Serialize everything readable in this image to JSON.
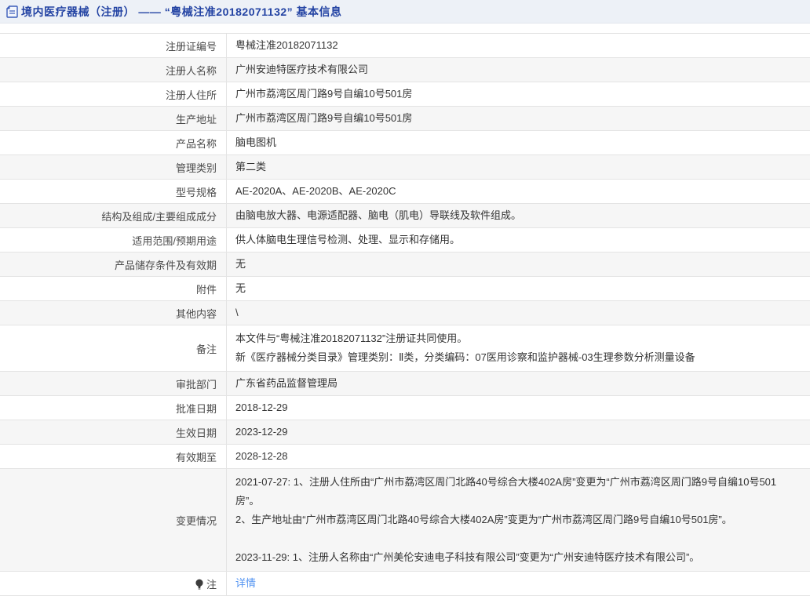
{
  "header": {
    "title": "境内医疗器械（注册） —— “粤械注准20182071132” 基本信息",
    "icon": "document-icon"
  },
  "colors": {
    "header_bg": "#edf1f7",
    "header_text": "#2343a3",
    "row_alt_bg": "#f6f6f6",
    "border": "#e4e4e4",
    "link": "#5595f2"
  },
  "table": {
    "rows": [
      {
        "label": "注册证编号",
        "value": "粤械注准20182071132"
      },
      {
        "label": "注册人名称",
        "value": "广州安迪特医疗技术有限公司"
      },
      {
        "label": "注册人住所",
        "value": "广州市荔湾区周门路9号自编10号501房"
      },
      {
        "label": "生产地址",
        "value": "广州市荔湾区周门路9号自编10号501房"
      },
      {
        "label": "产品名称",
        "value": "脑电图机"
      },
      {
        "label": "管理类别",
        "value": "第二类"
      },
      {
        "label": "型号规格",
        "value": "AE-2020A、AE-2020B、AE-2020C"
      },
      {
        "label": "结构及组成/主要组成成分",
        "value": "由脑电放大器、电源适配器、脑电（肌电）导联线及软件组成。"
      },
      {
        "label": "适用范围/预期用途",
        "value": "供人体脑电生理信号检测、处理、显示和存储用。"
      },
      {
        "label": "产品储存条件及有效期",
        "value": "无"
      },
      {
        "label": "附件",
        "value": "无"
      },
      {
        "label": "其他内容",
        "value": "\\"
      },
      {
        "label": "备注",
        "lines": [
          "本文件与“粤械注准20182071132”注册证共同使用。",
          "新《医疗器械分类目录》管理类别：Ⅱ类，分类编码：07医用诊察和监护器械-03生理参数分析测量设备"
        ]
      },
      {
        "label": "审批部门",
        "value": "广东省药品监督管理局"
      },
      {
        "label": "批准日期",
        "value": "2018-12-29"
      },
      {
        "label": "生效日期",
        "value": "2023-12-29"
      },
      {
        "label": "有效期至",
        "value": "2028-12-28"
      },
      {
        "label": "变更情况",
        "lines": [
          "2021-07-27: 1、注册人住所由“广州市荔湾区周门北路40号综合大楼402A房”变更为“广州市荔湾区周门路9号自编10号501房”。",
          "2、生产地址由“广州市荔湾区周门北路40号综合大楼402A房”变更为“广州市荔湾区周门路9号自编10号501房”。",
          "",
          "2023-11-29: 1、注册人名称由“广州美伦安迪电子科技有限公司”变更为“广州安迪特医疗技术有限公司”。"
        ]
      },
      {
        "label": "注",
        "link_label": "详情",
        "icon": "lightbulb-icon"
      }
    ]
  }
}
